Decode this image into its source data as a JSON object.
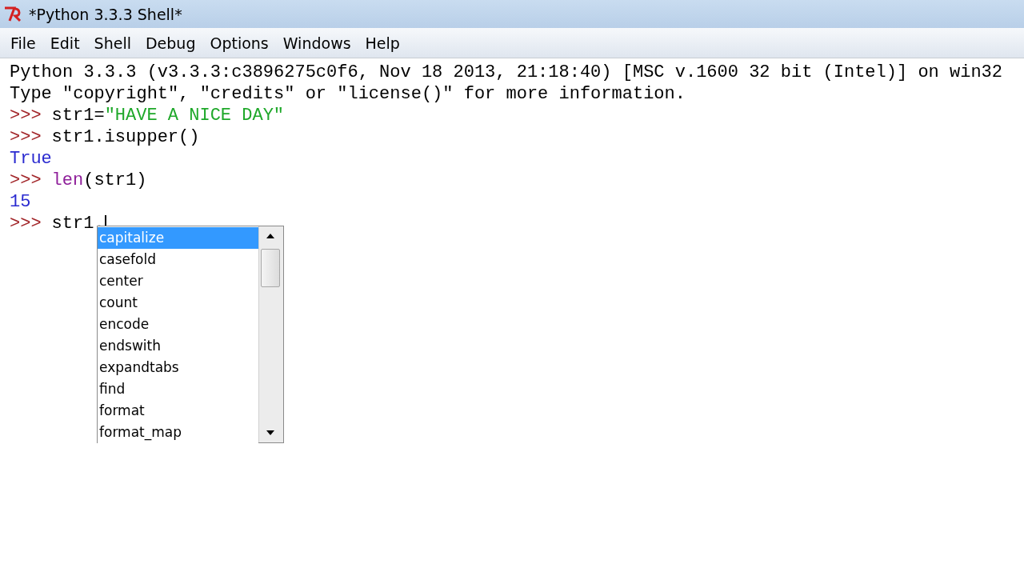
{
  "window": {
    "title": "*Python 3.3.3 Shell*"
  },
  "menu": [
    "File",
    "Edit",
    "Shell",
    "Debug",
    "Options",
    "Windows",
    "Help"
  ],
  "shell_lines": [
    [
      {
        "kind": "output",
        "text": "Python 3.3.3 (v3.3.3:c3896275c0f6, Nov 18 2013, 21:18:40) [MSC v.1600 32 bit (Intel)] on win32"
      }
    ],
    [
      {
        "kind": "output",
        "text": "Type \"copyright\", \"credits\" or \"license()\" for more information."
      }
    ],
    [
      {
        "kind": "prompt",
        "text": ">>>"
      },
      {
        "kind": "code",
        "text": "str1="
      },
      {
        "kind": "string",
        "text": "\"HAVE A NICE DAY\""
      }
    ],
    [
      {
        "kind": "prompt",
        "text": ">>>"
      },
      {
        "kind": "code",
        "text": "str1.isupper()"
      }
    ],
    [
      {
        "kind": "result",
        "text": "True"
      }
    ],
    [
      {
        "kind": "prompt",
        "text": ">>>"
      },
      {
        "kind": "builtin",
        "text": "len"
      },
      {
        "kind": "code",
        "text": "(str1)"
      }
    ],
    [
      {
        "kind": "result",
        "text": "15"
      }
    ],
    [
      {
        "kind": "prompt",
        "text": ">>>"
      },
      {
        "kind": "code",
        "text": "str1."
      }
    ]
  ],
  "completions": [
    {
      "label": "capitalize",
      "selected": true
    },
    {
      "label": "casefold",
      "selected": false
    },
    {
      "label": "center",
      "selected": false
    },
    {
      "label": "count",
      "selected": false
    },
    {
      "label": "encode",
      "selected": false
    },
    {
      "label": "endswith",
      "selected": false
    },
    {
      "label": "expandtabs",
      "selected": false
    },
    {
      "label": "find",
      "selected": false
    },
    {
      "label": "format",
      "selected": false
    },
    {
      "label": "format_map",
      "selected": false
    }
  ]
}
